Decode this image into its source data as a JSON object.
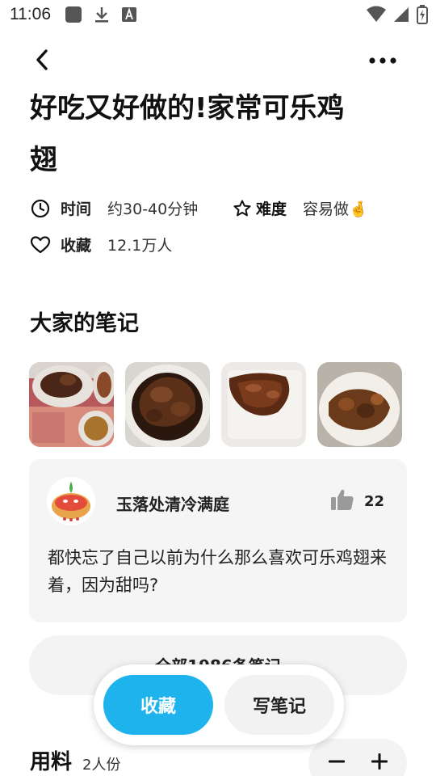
{
  "status_bar": {
    "time": "11:06",
    "icons": [
      "square-app-icon",
      "download-icon",
      "font-a-icon",
      "wifi-icon",
      "signal-icon",
      "battery-charging-icon"
    ]
  },
  "nav": {
    "back_icon": "chevron-left-icon",
    "more_icon": "more-horizontal-icon"
  },
  "recipe": {
    "title": "好吃又好做的!家常可乐鸡翅",
    "time_label": "时间",
    "time_value": "约30-40分钟",
    "difficulty_label": "难度",
    "difficulty_value": "容易做🤞",
    "collect_label": "收藏",
    "collect_value": "12.1万人"
  },
  "notes_section": {
    "title": "大家的笔记",
    "photos": [
      "note-photo-1",
      "note-photo-2",
      "note-photo-3",
      "note-photo-4"
    ],
    "featured_note": {
      "author": "玉落处清冷满庭",
      "likes": "22",
      "text": "都快忘了自己以前为什么那么喜欢可乐鸡翅来着，因为甜吗?"
    },
    "all_notes_label": "全部1986条笔记"
  },
  "ingredients": {
    "title": "用料",
    "servings": "2人份"
  },
  "action_bar": {
    "collect_button": "收藏",
    "write_note_button": "写笔记"
  },
  "colors": {
    "accent": "#1fb3ee",
    "card_bg": "#f5f5f5"
  }
}
